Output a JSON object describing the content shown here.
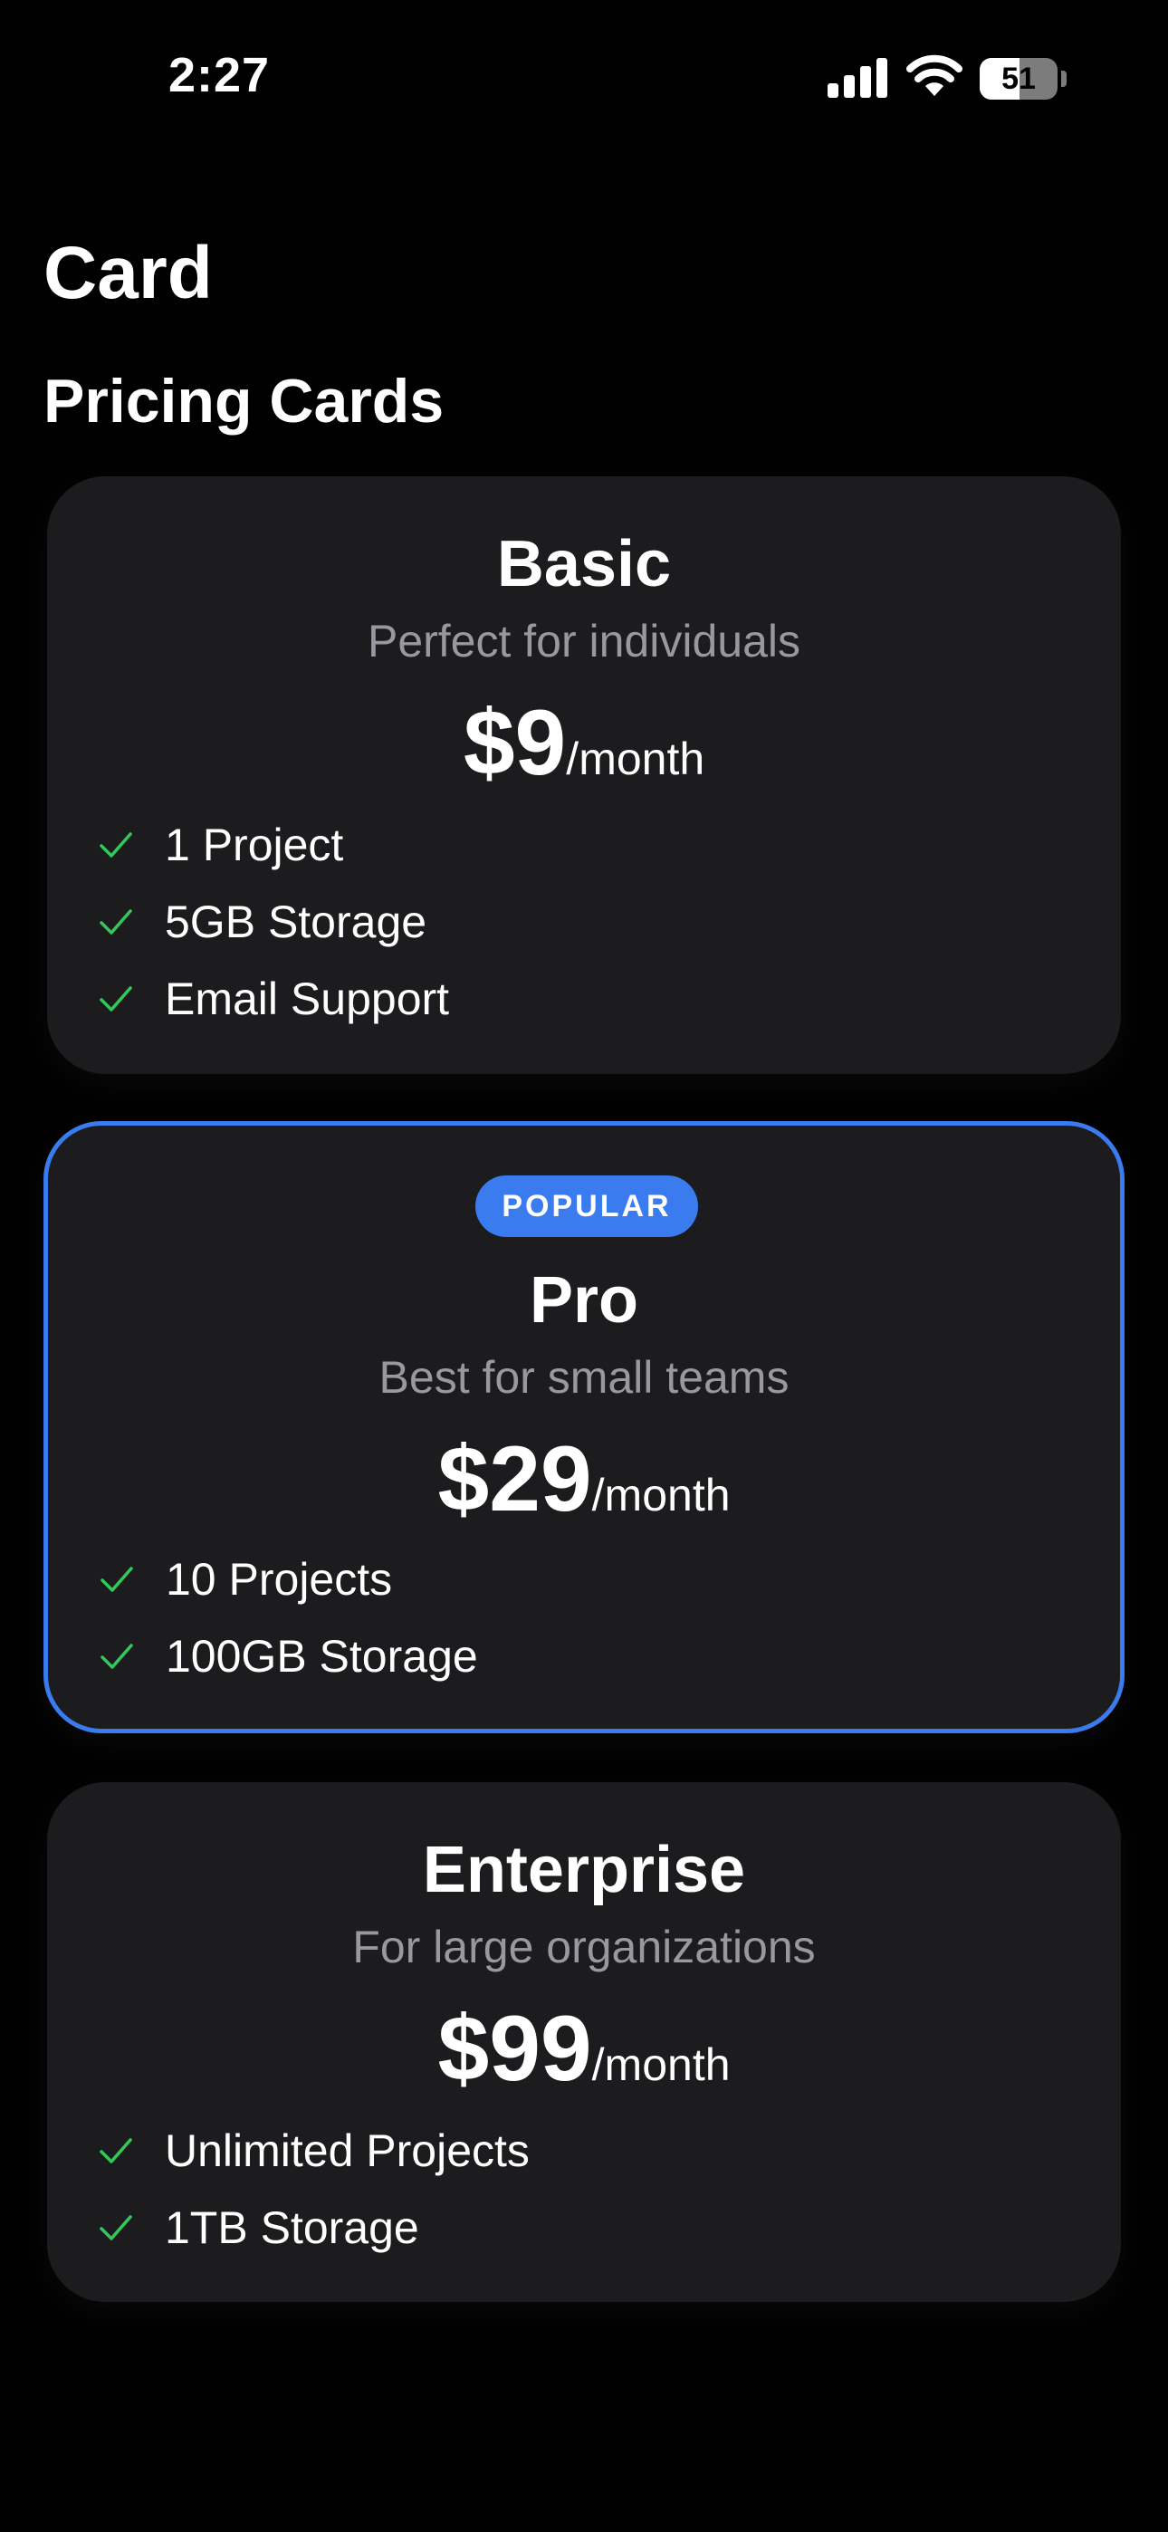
{
  "status_bar": {
    "time": "2:27",
    "battery_level": "51",
    "battery_fraction": 0.51,
    "signal_icon": "cellular-signal-icon",
    "wifi_icon": "wifi-icon",
    "battery_icon": "battery-icon"
  },
  "header": {
    "title": "Card",
    "section_title": "Pricing Cards"
  },
  "plans": [
    {
      "name": "Basic",
      "description": "Perfect for individuals",
      "price": "$9",
      "period": "/month",
      "features": [
        "1 Project",
        "5GB Storage",
        "Email Support"
      ]
    },
    {
      "badge": "POPULAR",
      "name": "Pro",
      "description": "Best for small teams",
      "price": "$29",
      "period": "/month",
      "features": [
        "10 Projects",
        "100GB Storage"
      ]
    },
    {
      "name": "Enterprise",
      "description": "For large organizations",
      "price": "$99",
      "period": "/month",
      "features": [
        "Unlimited Projects",
        "1TB Storage"
      ]
    }
  ],
  "colors": {
    "background": "#000000",
    "card_background": "#1c1c1e",
    "accent": "#3a7cf0",
    "check": "#34c759",
    "secondary_text": "#98989f"
  },
  "icons": {
    "feature_check": "checkmark-icon"
  }
}
